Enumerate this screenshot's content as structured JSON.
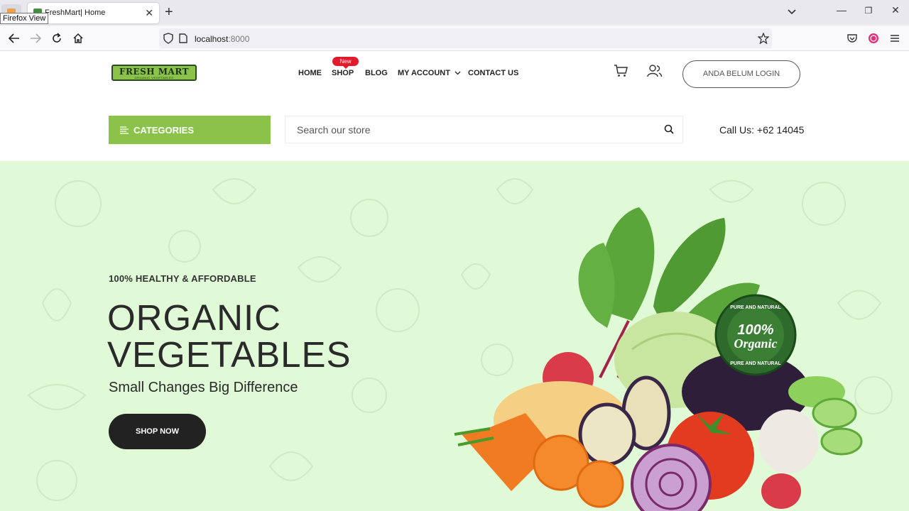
{
  "browser": {
    "tooltip": "Firefox View",
    "tab_title": "FreshMart| Home",
    "url_host": "localhost",
    "url_port": ":8000"
  },
  "header": {
    "logo_title": "FRESH MART",
    "logo_subtitle": "ORGANIC VEGETABLES",
    "nav": {
      "home": "HOME",
      "shop": "SHOP",
      "shop_badge": "New",
      "blog": "BLOG",
      "my_account": "MY ACCOUNT",
      "contact": "CONTACT US"
    },
    "login_label": "ANDA BELUM LOGIN"
  },
  "toolbar": {
    "categories_label": "CATEGORIES",
    "search_placeholder": "Search our store",
    "call_us": "Call Us: +62 14045"
  },
  "hero": {
    "tagline": "100% HEALTHY & AFFORDABLE",
    "title_line1": "ORGANIC",
    "title_line2": "VEGETABLES",
    "subtitle": "Small Changes Big Difference",
    "cta": "SHOP NOW",
    "badge_top": "PURE AND NATURAL",
    "badge_main1": "100%",
    "badge_main2": "Organic",
    "badge_bottom": "PURE AND NATURAL"
  },
  "colors": {
    "brand_green": "#8bc34a",
    "hero_bg": "#e0f9d6",
    "badge_red": "#e21b2c",
    "dark": "#222222"
  }
}
